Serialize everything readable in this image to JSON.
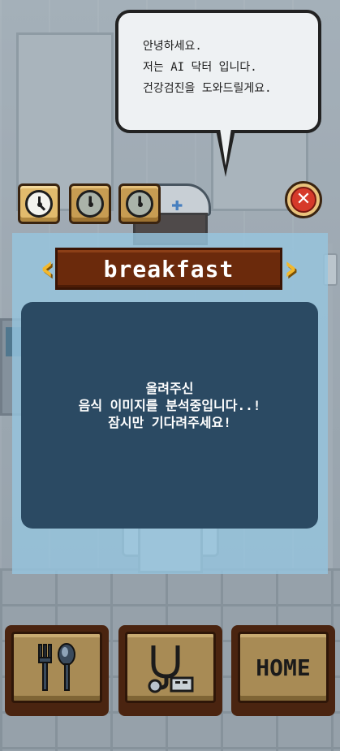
{
  "speech_bubble": {
    "lines": [
      "안녕하세요.",
      "저는 AI 닥터 입니다.",
      "건강검진을 도와드릴게요."
    ]
  },
  "meal_tabs": [
    {
      "icon": "clock-icon",
      "active": true
    },
    {
      "icon": "clock-icon",
      "active": false
    },
    {
      "icon": "clock-icon",
      "active": false
    }
  ],
  "close_button": {
    "icon": "close-icon"
  },
  "panel": {
    "title": "breakfast",
    "message_lines": [
      "올려주신",
      "음식 이미지를 분석중입니다..!",
      "잠시만 기다려주세요!"
    ]
  },
  "bottom_nav": {
    "food_icon": "fork-spoon-icon",
    "checkup_icon": "stethoscope-icon",
    "home_label": "HOME"
  },
  "colors": {
    "panel_bg": "#96c4de",
    "message_box": "#2b4a63",
    "banner": "#6b2a0c",
    "banner_arrows": "#f3b82c",
    "button_face": "#a88b55",
    "button_frame": "#4a2410",
    "close_red": "#d63a2a"
  }
}
